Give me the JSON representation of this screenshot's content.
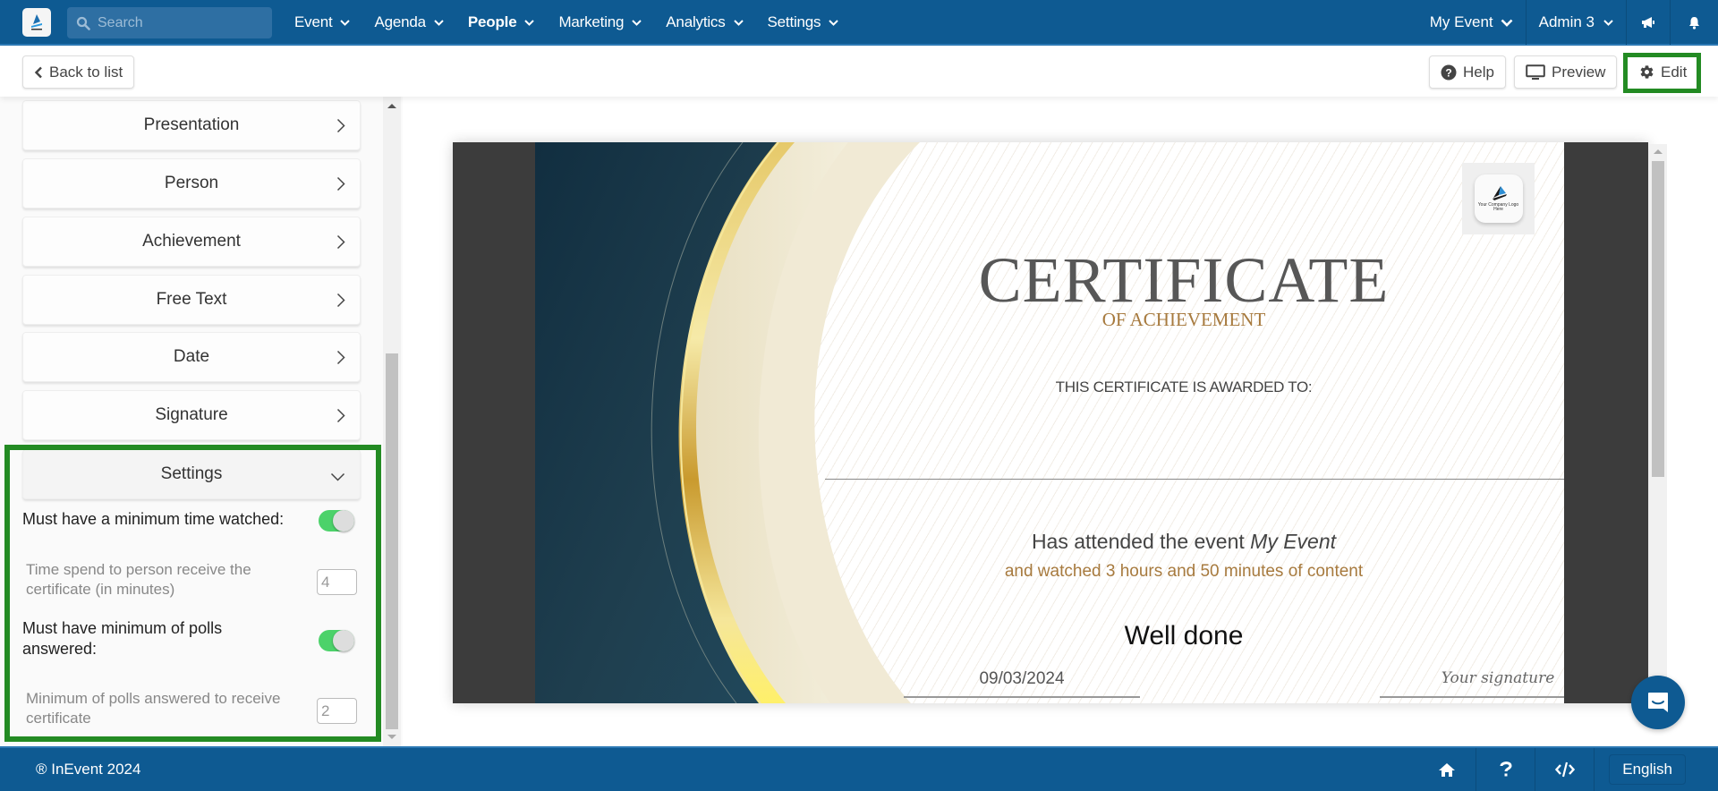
{
  "topnav": {
    "search_placeholder": "Search",
    "menu": [
      {
        "label": "Event",
        "bold": false
      },
      {
        "label": "Agenda",
        "bold": false
      },
      {
        "label": "People",
        "bold": true
      },
      {
        "label": "Marketing",
        "bold": false
      },
      {
        "label": "Analytics",
        "bold": false
      },
      {
        "label": "Settings",
        "bold": false
      }
    ],
    "event_selector": "My Event",
    "user_menu": "Admin 3",
    "icons": [
      "megaphone-icon",
      "bell-icon"
    ]
  },
  "toolbar": {
    "back_label": "Back to list",
    "help_label": "Help",
    "preview_label": "Preview",
    "edit_label": "Edit"
  },
  "sidebar": {
    "sections": [
      {
        "label": "Presentation"
      },
      {
        "label": "Person"
      },
      {
        "label": "Achievement"
      },
      {
        "label": "Free Text"
      },
      {
        "label": "Date"
      },
      {
        "label": "Signature"
      }
    ],
    "settings": {
      "label": "Settings",
      "expanded": true,
      "min_time_label": "Must have a minimum time watched:",
      "min_time_enabled": true,
      "time_spend_label": "Time spend to person receive the certificate (in minutes)",
      "time_spend_value": "4",
      "min_polls_label": "Must have minimum of polls answered:",
      "min_polls_enabled": true,
      "polls_required_label": "Minimum of polls answered to receive certificate",
      "polls_required_value": "2"
    }
  },
  "certificate": {
    "logo_text": "Your Company Logo Here",
    "title": "CERTIFICATE",
    "subtitle": "OF ACHIEVEMENT",
    "awarded_to": "THIS CERTIFICATE IS AWARDED TO:",
    "attended_prefix": "Has attended the event ",
    "event_name": "My Event",
    "watched": "and watched 3 hours and 50 minutes of content",
    "message": "Well done",
    "date": "09/03/2024",
    "signature": "Your signature"
  },
  "footer": {
    "copyright": "® InEvent 2024",
    "language": "English"
  },
  "colors": {
    "brand_blue": "#0e5a92",
    "highlight_green": "#238b23",
    "toggle_on": "#4cd26a",
    "gold": "#a77a3e"
  }
}
